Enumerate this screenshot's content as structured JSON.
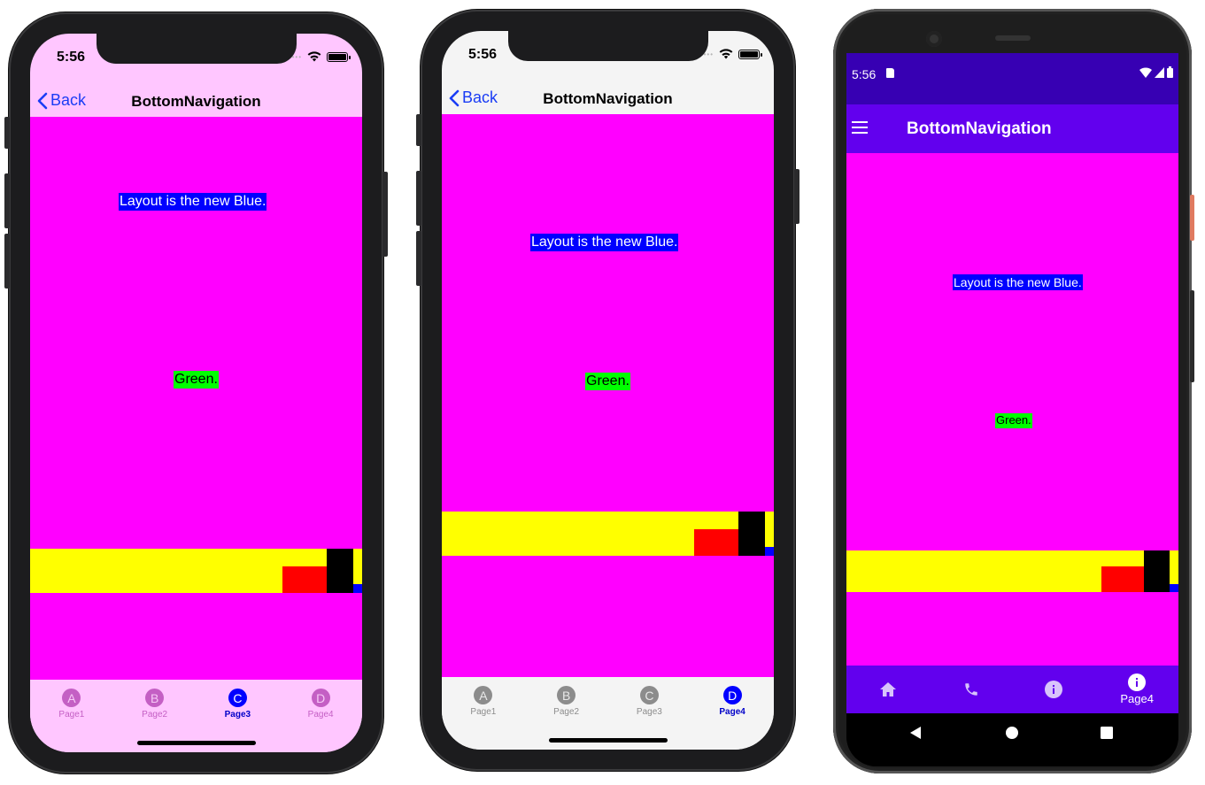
{
  "colors": {
    "content_bg": "#ff00ff",
    "blue_label_bg": "#0000ff",
    "green_label_bg": "#00ff00",
    "yellow_bar": "#ffff00",
    "red_block": "#ff0000",
    "black_block": "#000000",
    "blue_block": "#0000ff",
    "ios_tint": "#1a3cf5",
    "android_primary": "#6200ee",
    "android_status": "#3700b3"
  },
  "phone1": {
    "time": "5:56",
    "back_label": "Back",
    "title": "BottomNavigation",
    "label_blue": "Layout is the new Blue.",
    "label_green": "Green.",
    "tabs": [
      {
        "glyph": "A",
        "label": "Page1",
        "selected": false
      },
      {
        "glyph": "B",
        "label": "Page2",
        "selected": false
      },
      {
        "glyph": "C",
        "label": "Page3",
        "selected": true
      },
      {
        "glyph": "D",
        "label": "Page4",
        "selected": false
      }
    ]
  },
  "phone2": {
    "time": "5:56",
    "back_label": "Back",
    "title": "BottomNavigation",
    "label_blue": "Layout is the new Blue.",
    "label_green": "Green.",
    "tabs": [
      {
        "glyph": "A",
        "label": "Page1",
        "selected": false
      },
      {
        "glyph": "B",
        "label": "Page2",
        "selected": false
      },
      {
        "glyph": "C",
        "label": "Page3",
        "selected": false
      },
      {
        "glyph": "D",
        "label": "Page4",
        "selected": true
      }
    ]
  },
  "android": {
    "time": "5:56",
    "title": "BottomNavigation",
    "label_blue": "Layout is the new Blue.",
    "label_green": "Green.",
    "tabs": [
      {
        "icon": "home-icon",
        "label": "",
        "selected": false
      },
      {
        "icon": "phone-icon",
        "label": "",
        "selected": false
      },
      {
        "icon": "info-icon",
        "label": "",
        "selected": false
      },
      {
        "icon": "info-icon",
        "label": "Page4",
        "selected": true
      }
    ]
  }
}
